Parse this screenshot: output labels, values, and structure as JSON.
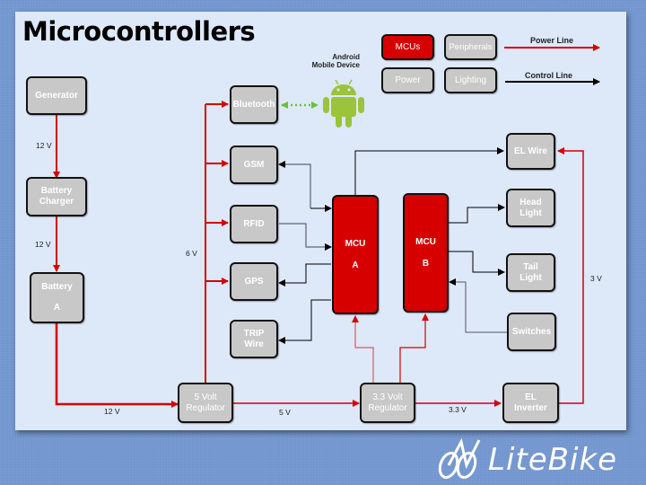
{
  "slide": {
    "title": "Microcontrollers"
  },
  "legend": {
    "categories": [
      {
        "label": "MCUs",
        "color": "#d60000"
      },
      {
        "label": "Peripherals",
        "color": "#c8c8c8"
      },
      {
        "label": "Power",
        "color": "#c8c8c8"
      },
      {
        "label": "Lighting",
        "color": "#c8c8c8"
      }
    ],
    "lines": [
      {
        "label": "Power Line",
        "color": "#d40000"
      },
      {
        "label": "Control Line",
        "color": "#000000"
      }
    ]
  },
  "android": {
    "label_line1": "Android",
    "label_line2": "Mobile Device",
    "color": "#9bc43a",
    "link_color": "#6cbf3a"
  },
  "nodes": {
    "generator": {
      "lines": [
        "Generator"
      ]
    },
    "battery_charger": {
      "lines": [
        "Battery",
        "Charger"
      ]
    },
    "battery": {
      "lines": [
        "Battery",
        "A"
      ]
    },
    "bluetooth": {
      "lines": [
        "Bluetooth"
      ]
    },
    "gsm": {
      "lines": [
        "GSM"
      ]
    },
    "rfid": {
      "lines": [
        "RFID"
      ]
    },
    "gps": {
      "lines": [
        "GPS"
      ]
    },
    "trip_wire": {
      "lines": [
        "TRIP",
        "Wire"
      ]
    },
    "mcu_a": {
      "lines": [
        "MCU",
        "A"
      ]
    },
    "mcu_b": {
      "lines": [
        "MCU",
        "B"
      ]
    },
    "el_wire": {
      "lines": [
        "EL Wire"
      ]
    },
    "head_light": {
      "lines": [
        "Head",
        "Light"
      ]
    },
    "tail_light": {
      "lines": [
        "Tail",
        "Light"
      ]
    },
    "switches": {
      "lines": [
        "Switches"
      ]
    },
    "reg_5v": {
      "lines": [
        "5 Volt",
        "Regulator"
      ]
    },
    "reg_3v3": {
      "lines": [
        "3.3 Volt",
        "Regulator"
      ]
    },
    "el_inverter": {
      "lines": [
        "EL",
        "Inverter"
      ]
    }
  },
  "voltage_labels": {
    "gen_to_charger": "12 V",
    "charger_to_battery": "12 V",
    "bus_6v": "6 V",
    "battery_to_reg": "12 V",
    "reg5_to_reg33": "5 V",
    "reg33_to_inverter": "3.3 V",
    "inverter_to_elwire": "3 V"
  },
  "logo": {
    "text": "LiteBike"
  }
}
